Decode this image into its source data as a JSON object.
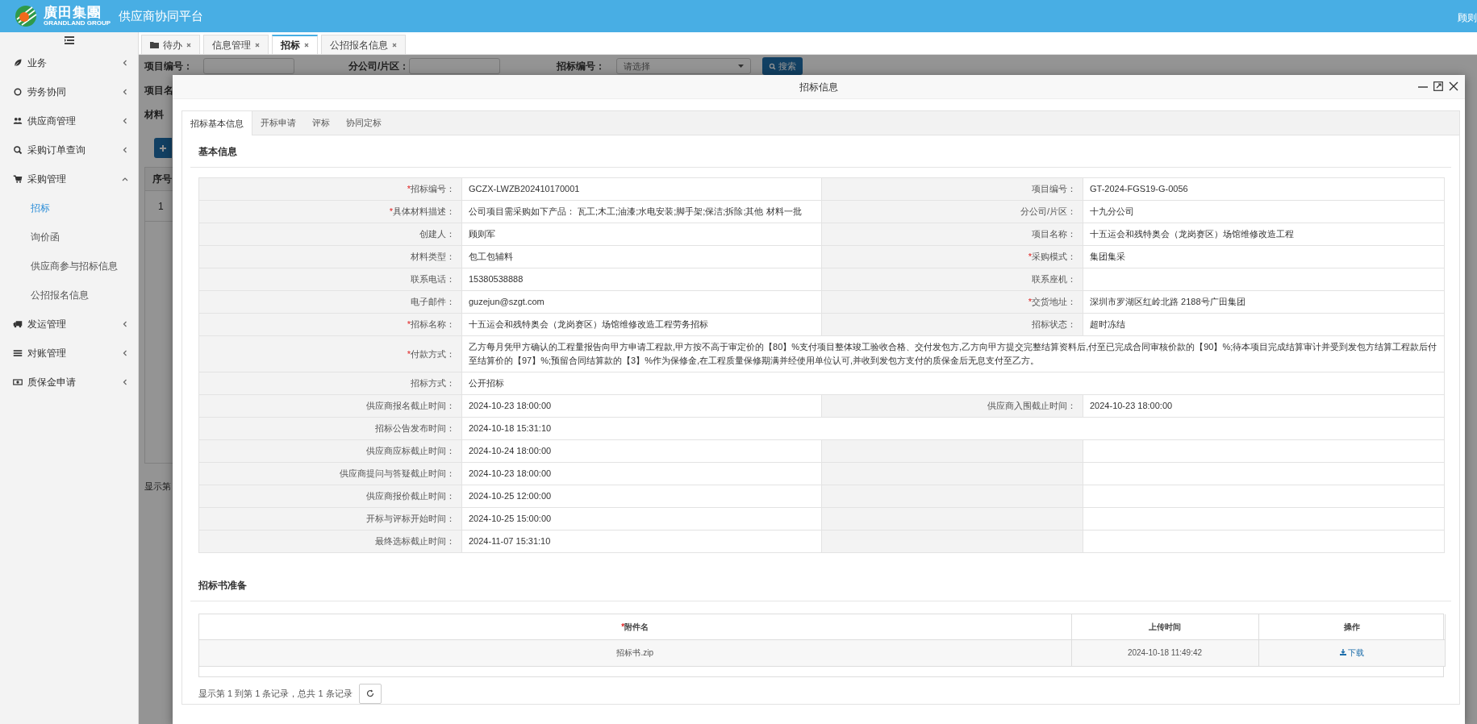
{
  "header": {
    "brand": "廣田集團",
    "brand_sub": "GRANDLAND GROUP",
    "title": "供应商协同平台",
    "user": "顾则"
  },
  "sidebar": {
    "items": [
      {
        "label": "业务",
        "expanded": false
      },
      {
        "label": "劳务协同",
        "expanded": false
      },
      {
        "label": "供应商管理",
        "expanded": false
      },
      {
        "label": "采购订单查询",
        "expanded": false
      },
      {
        "label": "采购管理",
        "expanded": true,
        "children": [
          {
            "label": "招标",
            "selected": true
          },
          {
            "label": "询价函",
            "selected": false
          },
          {
            "label": "供应商参与招标信息",
            "selected": false
          },
          {
            "label": "公招报名信息",
            "selected": false
          }
        ]
      },
      {
        "label": "发运管理",
        "expanded": false
      },
      {
        "label": "对账管理",
        "expanded": false
      },
      {
        "label": "质保金申请",
        "expanded": false
      }
    ]
  },
  "tabs": [
    {
      "label": "待办",
      "selected": false
    },
    {
      "label": "信息管理",
      "selected": false
    },
    {
      "label": "招标",
      "selected": true
    },
    {
      "label": "公招报名信息",
      "selected": false
    }
  ],
  "search_form": {
    "fields": [
      {
        "label": "项目编号："
      },
      {
        "label": "分公司/片区："
      },
      {
        "label": "招标编号：",
        "placeholder": "请选择"
      }
    ],
    "search_button": "搜索",
    "cut_labels": [
      "项目名",
      "材料"
    ]
  },
  "list_table": {
    "columns": [
      "序号"
    ],
    "rows": [
      [
        "1"
      ]
    ],
    "footer": "显示第"
  },
  "modal": {
    "title": "招标信息",
    "tabs": [
      {
        "label": "招标基本信息",
        "selected": true
      },
      {
        "label": "开标申请",
        "selected": false
      },
      {
        "label": "评标",
        "selected": false
      },
      {
        "label": "协同定标",
        "selected": false
      }
    ],
    "section_title": "基本信息",
    "rows": [
      {
        "kind": "pair",
        "fields": [
          {
            "label": "招标编号：",
            "mark": "*",
            "value": "GCZX-LWZB202410170001"
          },
          {
            "label": "项目编号：",
            "value": "GT-2024-FGS19-G-0056"
          }
        ]
      },
      {
        "kind": "pair",
        "fields": [
          {
            "label": "具体材料描述：",
            "mark": "*",
            "value": "公司项目需采购如下产品：  瓦工;木工;油漆;水电安装;脚手架;保洁;拆除;其他 材料一批"
          },
          {
            "label": "分公司/片区：",
            "value": "十九分公司"
          }
        ]
      },
      {
        "kind": "pair",
        "fields": [
          {
            "label": "创建人：",
            "value": "顾则军"
          },
          {
            "label": "项目名称：",
            "value": "十五运会和残特奥会（龙岗赛区）场馆维修改造工程"
          }
        ]
      },
      {
        "kind": "pair",
        "fields": [
          {
            "label": "材料类型：",
            "value": "包工包辅料"
          },
          {
            "label": "采购模式：",
            "mark": "*",
            "value": "集团集采"
          }
        ]
      },
      {
        "kind": "pair",
        "fields": [
          {
            "label": "联系电话：",
            "value": "15380538888"
          },
          {
            "label": "联系座机："
          }
        ]
      },
      {
        "kind": "pair",
        "fields": [
          {
            "label": "电子邮件：",
            "value": "guzejun@szgt.com"
          },
          {
            "label": "交货地址：",
            "mark": "*",
            "value": "深圳市罗湖区红岭北路 2188号广田集团"
          }
        ]
      },
      {
        "kind": "pair",
        "fields": [
          {
            "label": "招标名称：",
            "mark": "*",
            "value": "十五运会和残特奥会（龙岗赛区）场馆维修改造工程劳务招标"
          },
          {
            "label": "招标状态：",
            "value": "超时冻结"
          }
        ]
      },
      {
        "kind": "wide",
        "fields": [
          {
            "label": "付款方式：",
            "mark": "*",
            "value": "乙方每月凭甲方确认的工程量报告向甲方申请工程款,甲方按不高于审定价的【80】%支付项目整体竣工验收合格、交付发包方,乙方向甲方提交完整结算资料后,付至已完成合同审核价款的【90】%;待本项目完成结算审计并受到发包方结算工程款后付至结算价的【97】%;预留合同结算款的【3】%作为保修金,在工程质量保修期满并经使用单位认可,并收到发包方支付的质保金后无息支付至乙方。"
          }
        ]
      },
      {
        "kind": "wide",
        "fields": [
          {
            "label": "招标方式：",
            "value": "公开招标"
          }
        ]
      },
      {
        "kind": "pair",
        "fields": [
          {
            "label": "供应商报名截止时间：",
            "value": "2024-10-23 18:00:00"
          },
          {
            "label": "供应商入围截止时间：",
            "value": "2024-10-23 18:00:00"
          }
        ]
      },
      {
        "kind": "wide",
        "fields": [
          {
            "label": "招标公告发布时间：",
            "value": "2024-10-18 15:31:10"
          }
        ]
      },
      {
        "kind": "half",
        "fields": [
          {
            "label": "供应商应标截止时间：",
            "value": "2024-10-24 18:00:00"
          }
        ]
      },
      {
        "kind": "half",
        "fields": [
          {
            "label": "供应商提问与答疑截止时间：",
            "value": "2024-10-23 18:00:00"
          }
        ]
      },
      {
        "kind": "half",
        "fields": [
          {
            "label": "供应商报价截止时间：",
            "value": "2024-10-25 12:00:00"
          }
        ]
      },
      {
        "kind": "half",
        "fields": [
          {
            "label": "开标与评标开始时间：",
            "value": "2024-10-25 15:00:00"
          }
        ]
      },
      {
        "kind": "half",
        "fields": [
          {
            "label": "最终选标截止时间：",
            "value": "2024-11-07 15:31:10"
          }
        ]
      }
    ],
    "attachments": {
      "title": "招标书准备",
      "columns": [
        {
          "label": "附件名",
          "mark": "*"
        },
        {
          "label": "上传时间"
        },
        {
          "label": "操作"
        }
      ],
      "rows": [
        {
          "name": "招标书.zip",
          "uploaded": "2024-10-18 11:49:42",
          "action": "下载"
        }
      ],
      "summary": "显示第 1 到第 1 条记录，总共 1 条记录"
    }
  }
}
